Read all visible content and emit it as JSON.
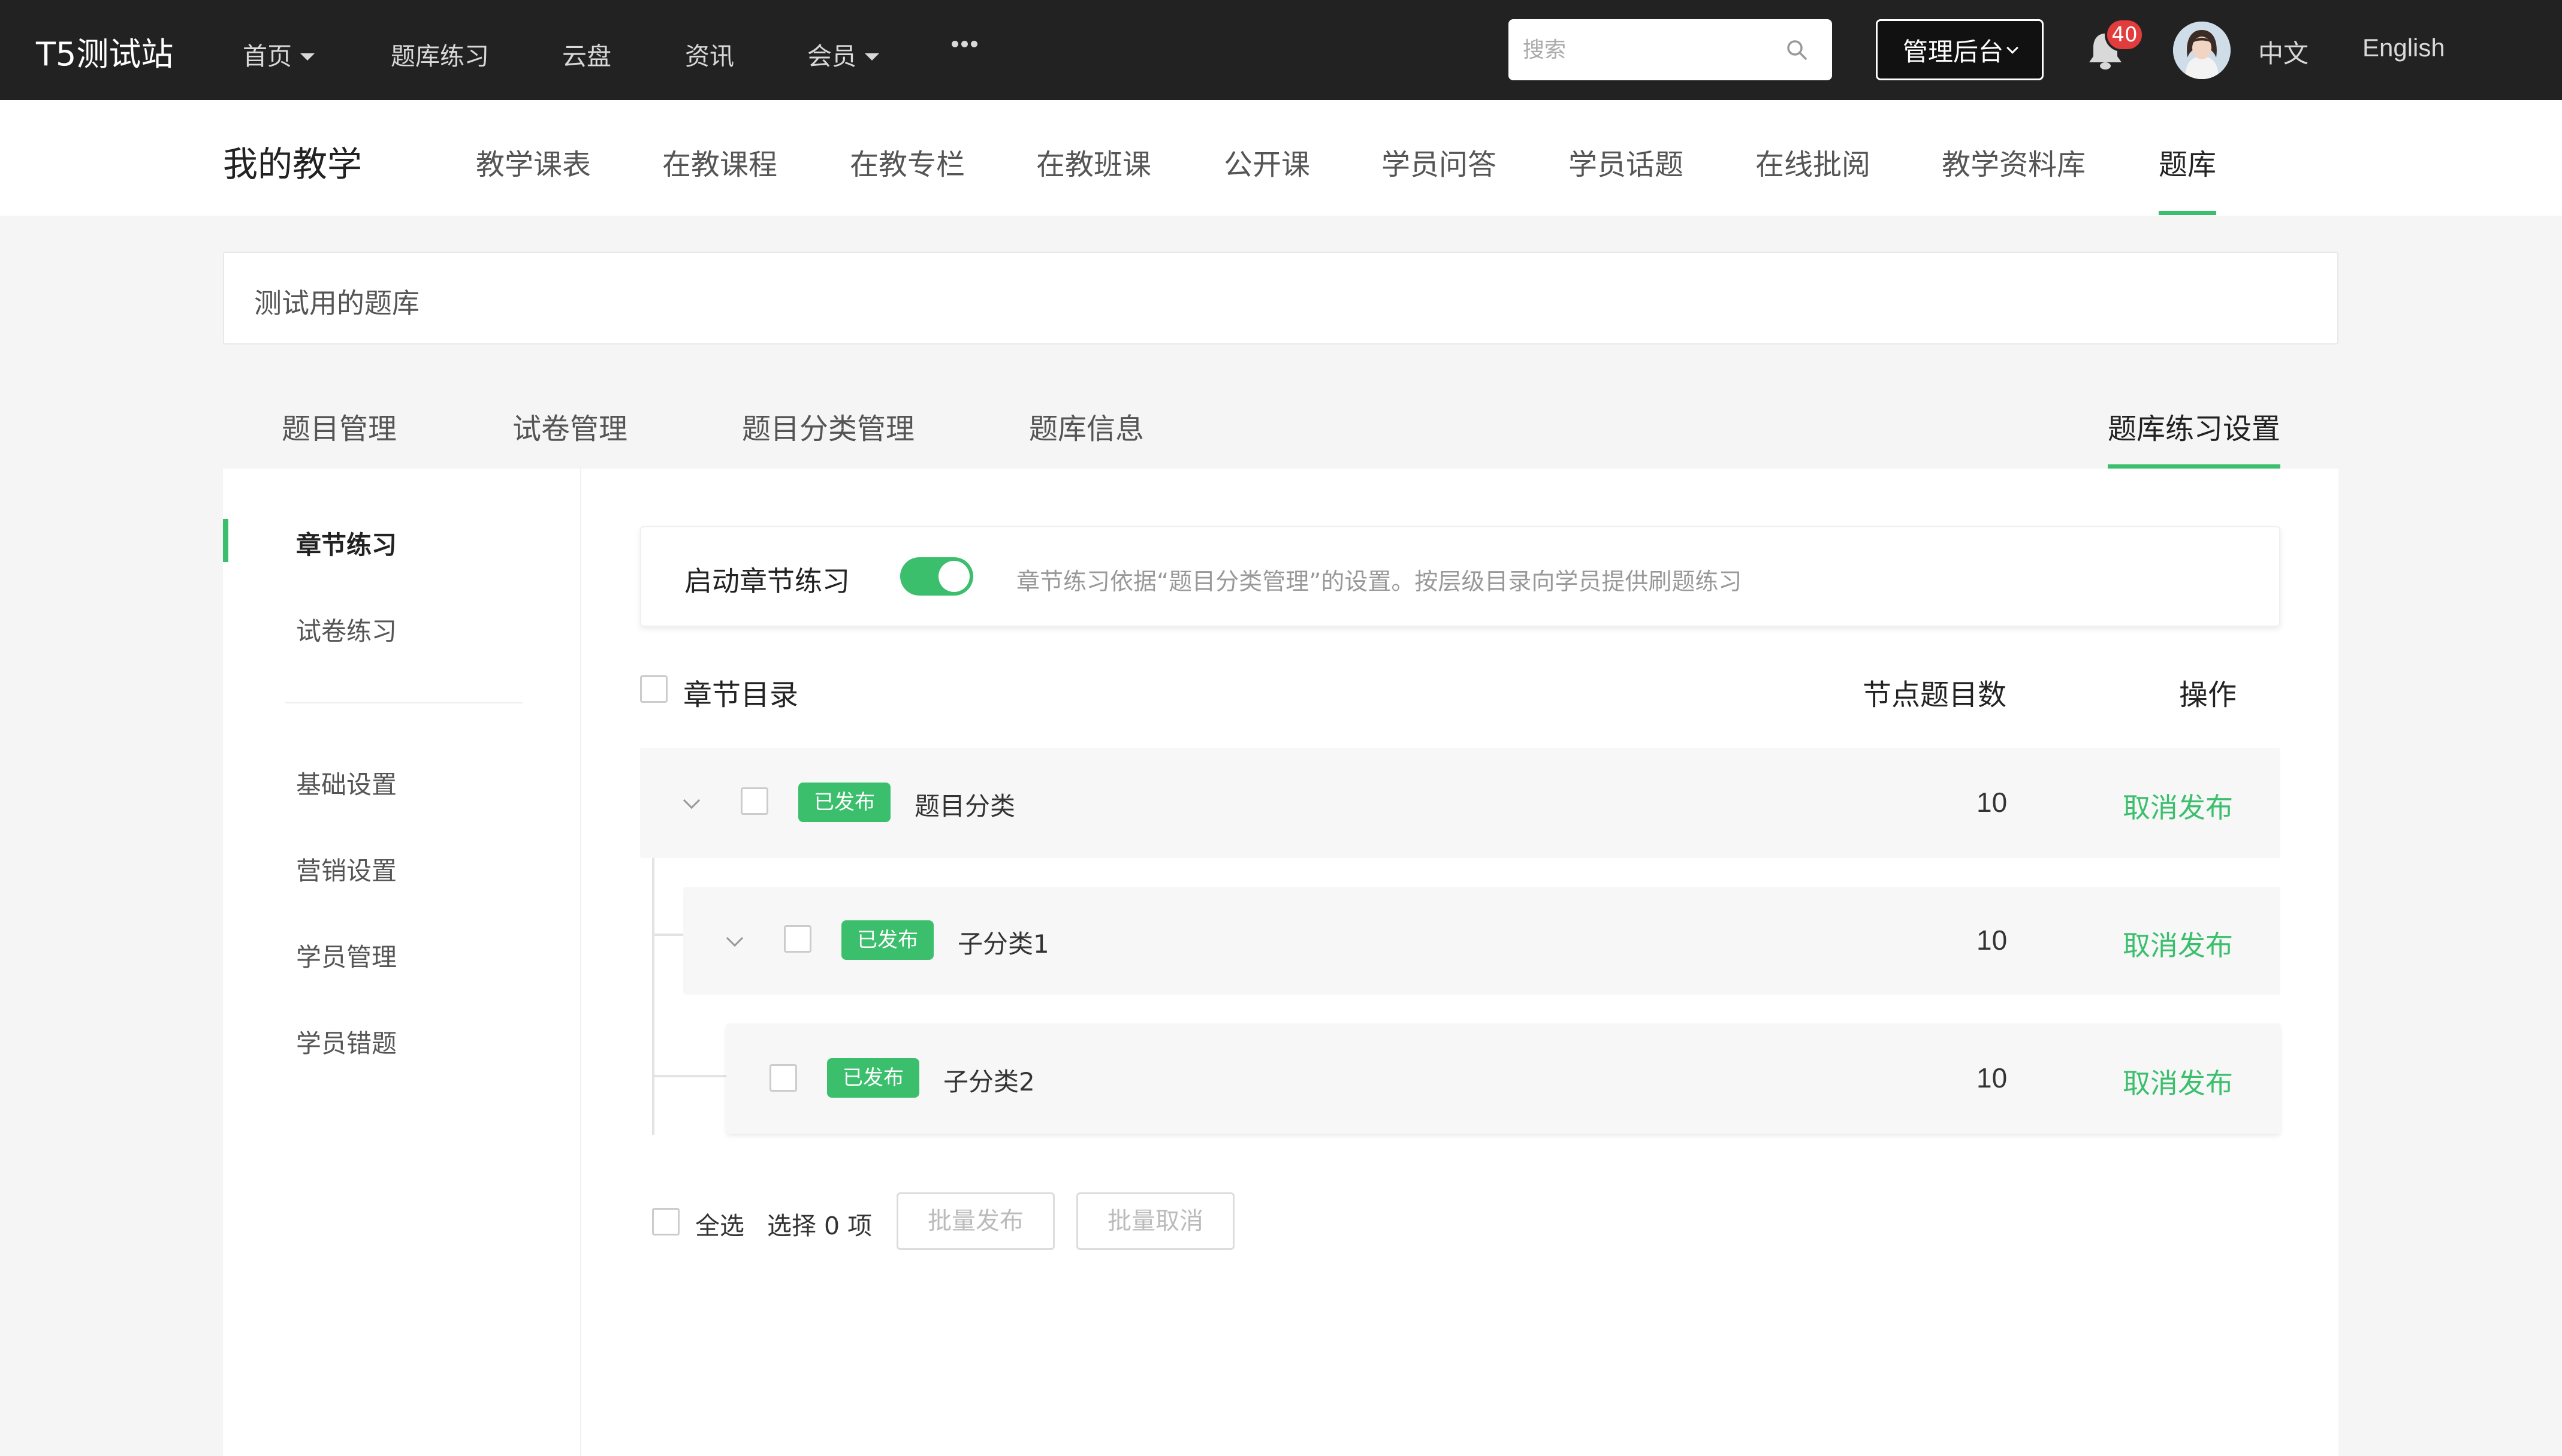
{
  "topbar": {
    "brand": "T5测试站",
    "nav": [
      {
        "label": "首页",
        "has_caret": true
      },
      {
        "label": "题库练习",
        "has_caret": false
      },
      {
        "label": "云盘",
        "has_caret": false
      },
      {
        "label": "资讯",
        "has_caret": false
      },
      {
        "label": "会员",
        "has_caret": true
      }
    ],
    "more_icon": "ellipsis-icon",
    "search_placeholder": "搜索",
    "admin_label": "管理后台",
    "notification_count": "40",
    "lang_zh": "中文",
    "lang_en": "English"
  },
  "subnav": {
    "title": "我的教学",
    "items": [
      "教学课表",
      "在教课程",
      "在教专栏",
      "在教班课",
      "公开课",
      "学员问答",
      "学员话题",
      "在线批阅",
      "教学资料库",
      "题库"
    ],
    "active_index": 9
  },
  "bank": {
    "name": "测试用的题库"
  },
  "tabs": {
    "items": [
      "题目管理",
      "试卷管理",
      "题目分类管理",
      "题库信息",
      "题库练习设置"
    ],
    "active_index": 4
  },
  "sidebar": {
    "items": [
      "章节练习",
      "试卷练习",
      "基础设置",
      "营销设置",
      "学员管理",
      "学员错题"
    ],
    "active_index": 0
  },
  "toggle": {
    "label": "启动章节练习",
    "enabled": true,
    "description": "章节练习依据“题目分类管理”的设置。按层级目录向学员提供刷题练习"
  },
  "table": {
    "headers": {
      "directory": "章节目录",
      "count": "节点题目数",
      "action": "操作"
    },
    "rows": [
      {
        "status": "已发布",
        "name": "题目分类",
        "count": "10",
        "action": "取消发布",
        "level": 0
      },
      {
        "status": "已发布",
        "name": "子分类1",
        "count": "10",
        "action": "取消发布",
        "level": 1
      },
      {
        "status": "已发布",
        "name": "子分类2",
        "count": "10",
        "action": "取消发布",
        "level": 2
      }
    ]
  },
  "footer": {
    "select_all": "全选",
    "selected_text": "选择 0 项",
    "batch_publish": "批量发布",
    "batch_cancel": "批量取消"
  },
  "colors": {
    "accent": "#3bbf6d",
    "topbar_bg": "#222222",
    "badge_red": "#e23c3c"
  }
}
